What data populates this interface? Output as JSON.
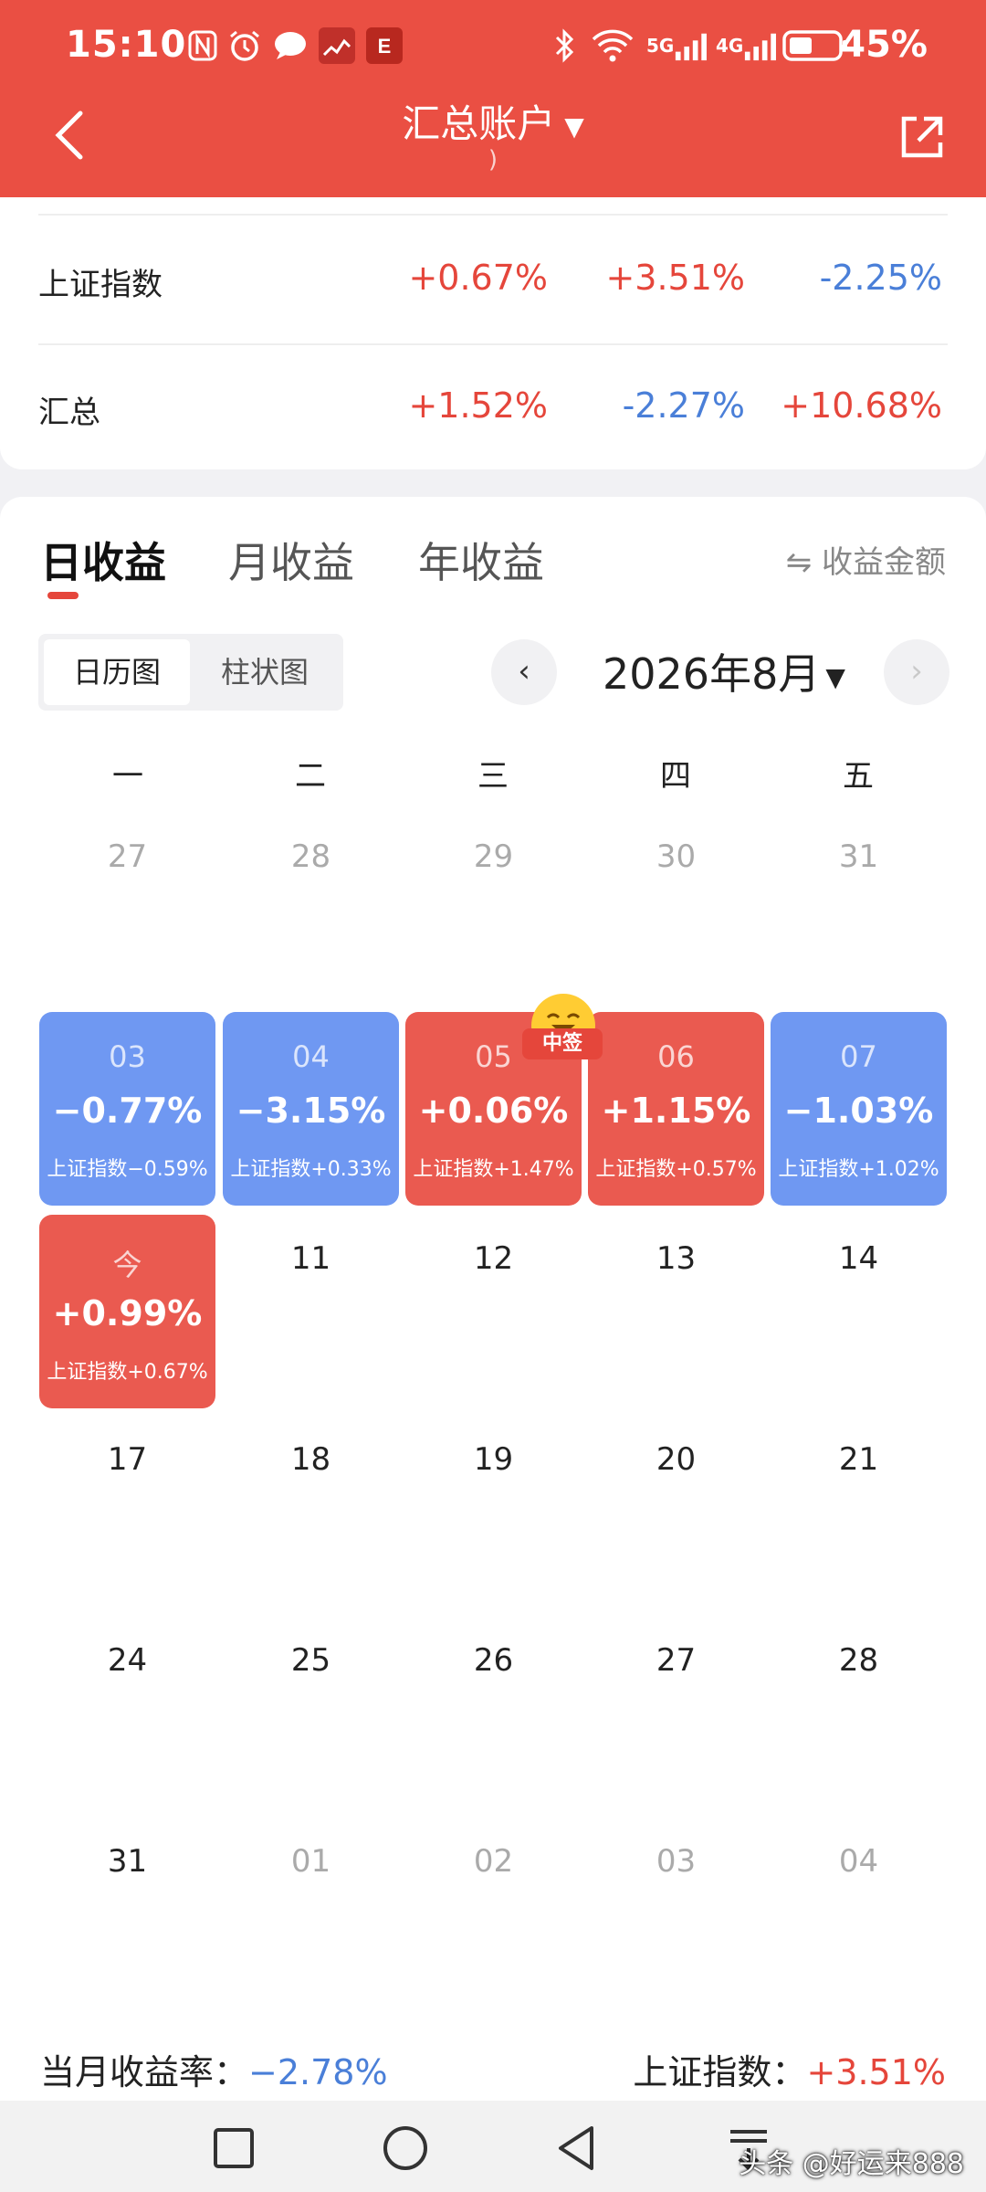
{
  "status_bar": {
    "time": "15:10",
    "battery_percent": "45%",
    "network_1": "5G",
    "network_2": "4G"
  },
  "header": {
    "title": "汇总账户",
    "subtitle": ")",
    "caret": "▼"
  },
  "index_table": {
    "rows": [
      {
        "name": "上证指数",
        "values": [
          "+0.67%",
          "+3.51%",
          "-2.25%"
        ]
      },
      {
        "name": "汇总",
        "values": [
          "+1.52%",
          "-2.27%",
          "+10.68%"
        ]
      }
    ]
  },
  "tabs": {
    "items": [
      "日收益",
      "月收益",
      "年收益"
    ],
    "active_index": 0,
    "amount_toggle": "⇋ 收益金额"
  },
  "view_toggle": {
    "options": [
      "日历图",
      "柱状图"
    ],
    "selected": "日历图"
  },
  "month": {
    "label": "2026年8月",
    "caret": "▼",
    "prev": "‹",
    "next": "›"
  },
  "weekdays": [
    "一",
    "二",
    "三",
    "四",
    "五"
  ],
  "calendar": {
    "prev_month_days": [
      "27",
      "28",
      "29",
      "30",
      "31"
    ],
    "performance": [
      {
        "day": "03",
        "pct": "−0.77%",
        "index": "上证指数−0.59%",
        "trend": "down"
      },
      {
        "day": "04",
        "pct": "−3.15%",
        "index": "上证指数+0.33%",
        "trend": "down"
      },
      {
        "day": "05",
        "pct": "+0.06%",
        "index": "上证指数+1.47%",
        "trend": "up"
      },
      {
        "day": "06",
        "pct": "+1.15%",
        "index": "上证指数+0.57%",
        "trend": "up"
      },
      {
        "day": "07",
        "pct": "−1.03%",
        "index": "上证指数+1.02%",
        "trend": "down"
      },
      {
        "day": "今",
        "pct": "+0.99%",
        "index": "上证指数+0.67%",
        "trend": "up"
      }
    ],
    "row3_days": [
      "11",
      "12",
      "13",
      "14"
    ],
    "row4_days": [
      "17",
      "18",
      "19",
      "20",
      "21"
    ],
    "row5_days": [
      "24",
      "25",
      "26",
      "27",
      "28"
    ],
    "row6_days": [
      "31",
      "01",
      "02",
      "03",
      "04"
    ],
    "sticker_label": "中签"
  },
  "summary": {
    "month_label": "当月收益率：",
    "month_value": "−2.78%",
    "index_label": "上证指数：",
    "index_value": "+3.51%"
  },
  "watermark": "头条 @好运来888",
  "colors": {
    "header_red": "#ea4f43",
    "up_red": "#e5463b",
    "down_blue": "#4a7fd8",
    "cell_red": "#ea5a50",
    "cell_blue": "#6f98f2"
  }
}
